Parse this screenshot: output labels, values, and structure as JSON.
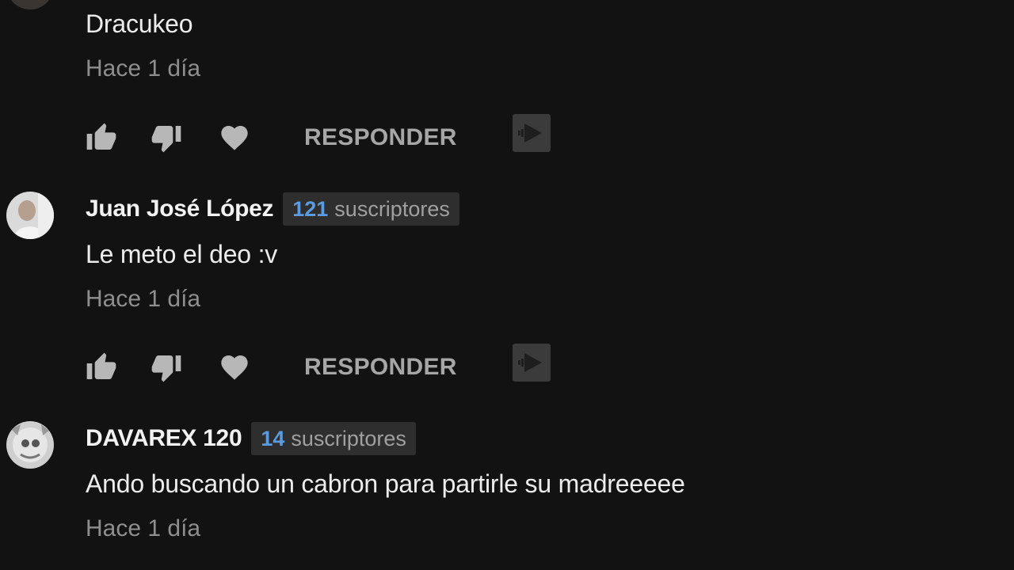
{
  "comments": [
    {
      "author": "",
      "subscriber_count": "",
      "subscriber_label": "",
      "text": "Dracukeo",
      "time": "Hace 1 día",
      "reply_label": "RESPONDER"
    },
    {
      "author": "Juan José López",
      "subscriber_count": "121",
      "subscriber_label": "suscriptores",
      "text": "Le meto el deo :v",
      "time": "Hace 1 día",
      "reply_label": "RESPONDER"
    },
    {
      "author": "DAVAREX 120",
      "subscriber_count": "14",
      "subscriber_label": "suscriptores",
      "text": "Ando buscando un cabron para partirle su madreeeee",
      "time": "Hace 1 día"
    }
  ],
  "icons": {
    "like": "thumb-up-icon",
    "dislike": "thumb-down-icon",
    "heart": "heart-icon",
    "share": "share-video-icon"
  },
  "colors": {
    "background": "#121212",
    "subscriber_count": "#5b9be0",
    "badge_background": "#2e2e2e",
    "secondary_text": "#8e8e8e"
  }
}
